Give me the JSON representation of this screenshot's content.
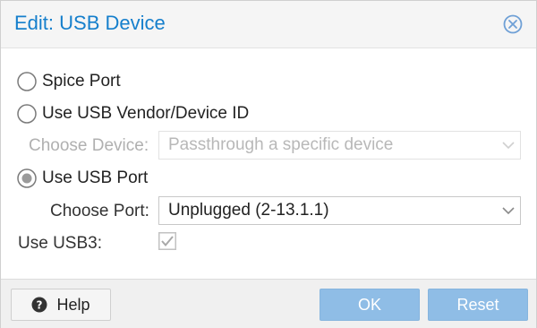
{
  "dialog": {
    "title": "Edit: USB Device",
    "close_icon": "close-icon"
  },
  "options": {
    "spice_port": {
      "label": "Spice Port",
      "checked": false
    },
    "vendor_device": {
      "label": "Use USB Vendor/Device ID",
      "checked": false
    },
    "usb_port": {
      "label": "Use USB Port",
      "checked": true
    }
  },
  "fields": {
    "choose_device": {
      "label": "Choose Device:",
      "value": "Passthrough a specific device",
      "disabled": true
    },
    "choose_port": {
      "label": "Choose Port:",
      "value": "Unplugged (2-13.1.1)",
      "disabled": false
    },
    "usb3": {
      "label": "Use USB3:",
      "checked": true,
      "disabled": true
    }
  },
  "footer": {
    "help_label": "Help",
    "ok_label": "OK",
    "reset_label": "Reset"
  },
  "colors": {
    "accent": "#157fcc",
    "primary_button": "#8fbde6"
  }
}
